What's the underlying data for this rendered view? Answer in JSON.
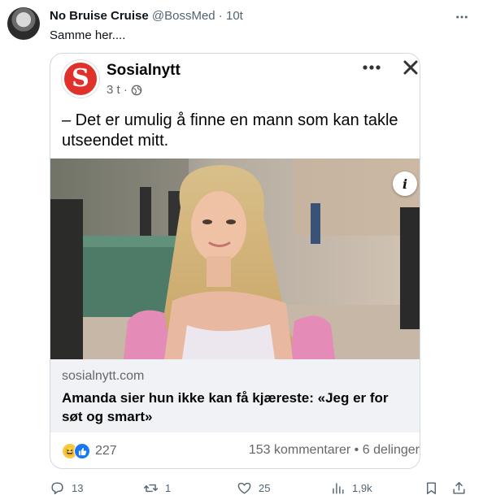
{
  "tweet": {
    "display_name": "No Bruise Cruise",
    "handle": "@BossMed",
    "separator": " · ",
    "time": "10t",
    "text": "Samme her....",
    "more_icon": "more-horizontal-icon"
  },
  "embedded_post": {
    "page_name": "Sosialnytt",
    "logo_letter": "S",
    "time": "3 t ·",
    "post_text": "– Det er umulig å finne en mann som kan takle utseendet mitt.",
    "info_label": "i",
    "link_domain": "sosialnytt.com",
    "link_title": "Amanda sier hun ikke kan få kjæreste: «Jeg er for søt og smart»",
    "reaction_count": "227",
    "engagement": "153 kommentarer • 6 delinger",
    "colors": {
      "logo_red": "#e0322b",
      "like_blue": "#1877f2",
      "haha_yellow": "#f7c948"
    }
  },
  "actions": {
    "replies": "13",
    "retweets": "1",
    "likes": "25",
    "views": "1,9k"
  }
}
